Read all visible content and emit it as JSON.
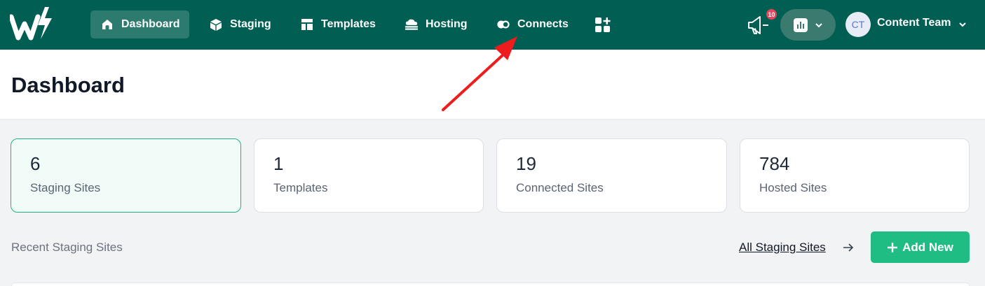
{
  "nav": {
    "items": [
      {
        "label": "Dashboard",
        "icon": "home-icon",
        "active": true
      },
      {
        "label": "Staging",
        "icon": "cube-icon",
        "active": false
      },
      {
        "label": "Templates",
        "icon": "layout-icon",
        "active": false
      },
      {
        "label": "Hosting",
        "icon": "cloud-server-icon",
        "active": false
      },
      {
        "label": "Connects",
        "icon": "connect-icon",
        "active": false
      }
    ],
    "notification_count": "10",
    "user": {
      "initials": "CT",
      "name": "Content Team"
    }
  },
  "header": {
    "title": "Dashboard"
  },
  "stats": [
    {
      "value": "6",
      "label": "Staging Sites",
      "active": true
    },
    {
      "value": "1",
      "label": "Templates",
      "active": false
    },
    {
      "value": "19",
      "label": "Connected Sites",
      "active": false
    },
    {
      "value": "784",
      "label": "Hosted Sites",
      "active": false
    }
  ],
  "recent": {
    "label": "Recent Staging Sites",
    "all_link": "All Staging Sites",
    "add_label": "Add New"
  },
  "colors": {
    "nav_bg": "#005e52",
    "accent": "#1fbc84",
    "badge": "#e8445c",
    "annotation": "#ee1c1c"
  }
}
